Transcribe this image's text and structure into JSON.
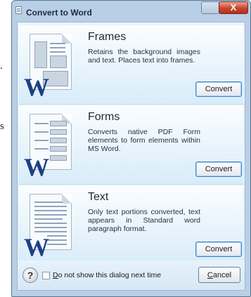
{
  "background_fragments": [
    ".",
    "s"
  ],
  "window": {
    "title": "Convert to Word",
    "close_glyph": "X"
  },
  "options": [
    {
      "title": "Frames",
      "description": "Retains the background images and text.  Places text into frames.",
      "button": "Convert",
      "icon": "word-frames-document-icon"
    },
    {
      "title": "Forms",
      "description": "Converts native PDF Form elements to form elements within MS Word.",
      "button": "Convert",
      "icon": "word-forms-document-icon"
    },
    {
      "title": "Text",
      "description": "Only text portions converted, text appears in Standard word paragraph format.",
      "button": "Convert",
      "icon": "word-text-document-icon"
    }
  ],
  "footer": {
    "help_glyph": "?",
    "checkbox_mnemonic": "D",
    "checkbox_rest": "o not show this dialog next time",
    "checkbox_checked": false,
    "cancel_mnemonic": "C",
    "cancel_rest": "ancel"
  },
  "colors": {
    "accent_border": "#3f82c4",
    "word_blue": "#1c3f85",
    "close_red": "#c9442c"
  }
}
